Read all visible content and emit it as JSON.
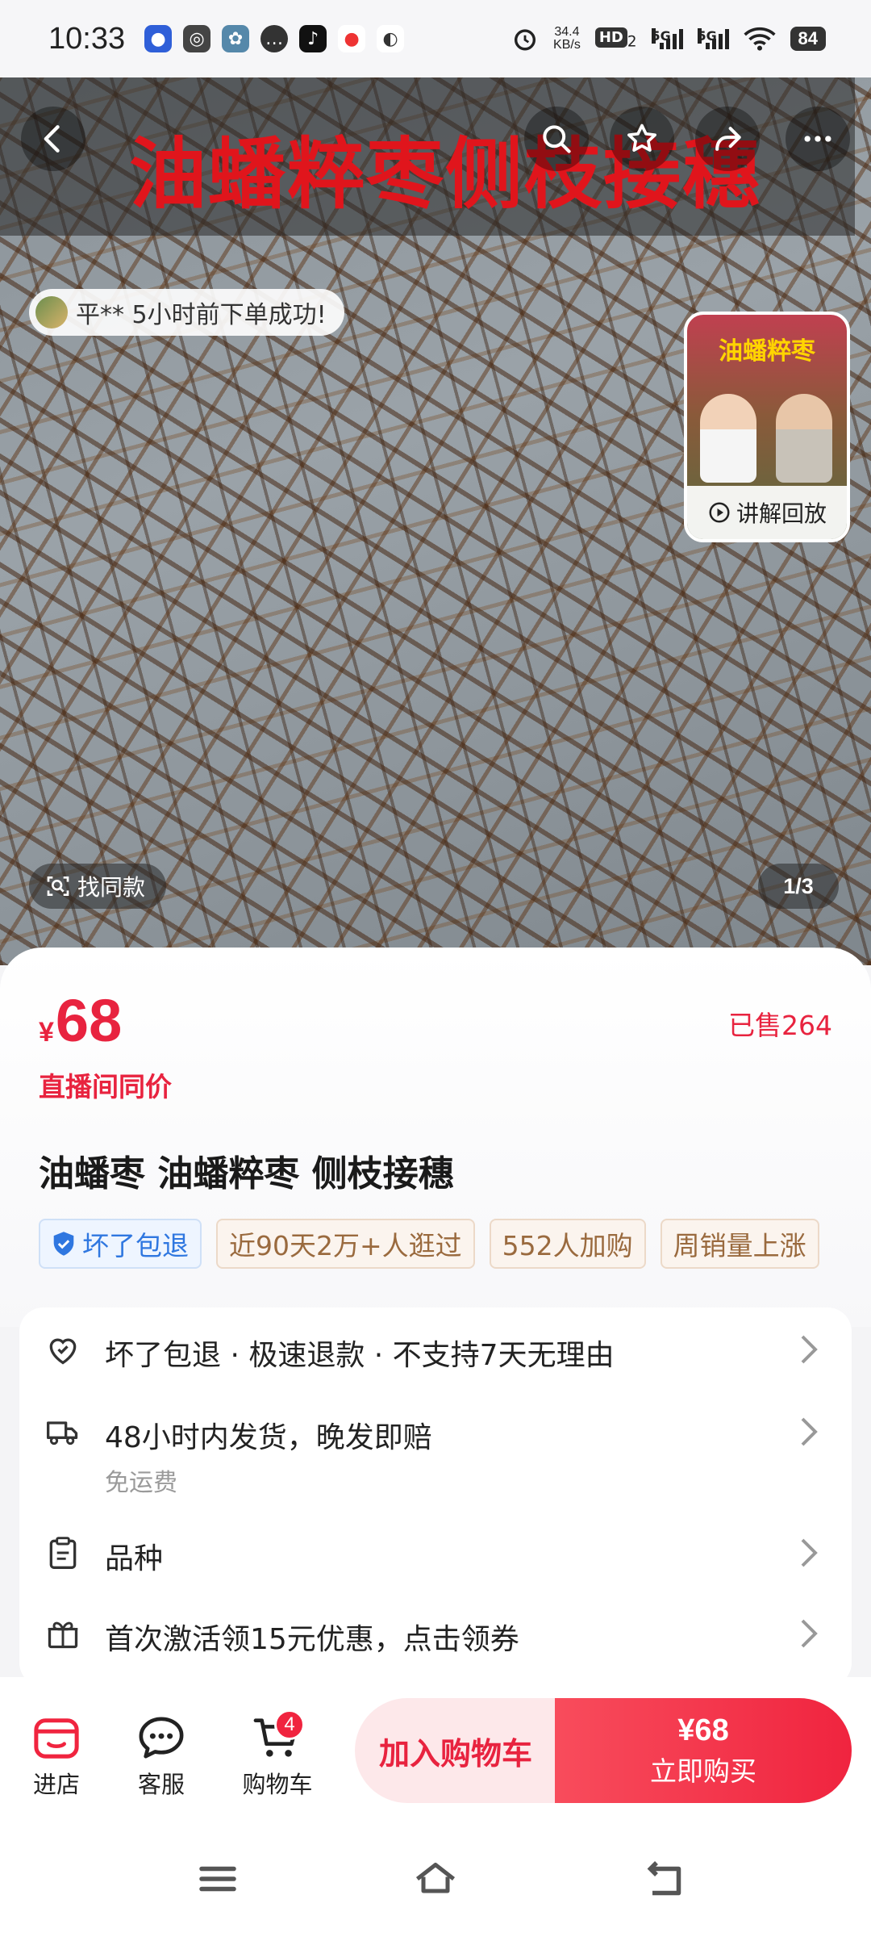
{
  "status_bar": {
    "time": "10:33",
    "net_speed_value": "34.4",
    "net_speed_unit": "KB/s",
    "hd_label": "HD",
    "hd_sub": "2",
    "signal1_label": "5G",
    "signal2_label": "5G",
    "battery": "84"
  },
  "hero": {
    "banner_text": "油蟠粹枣侧枝接穗",
    "order_toast": "平** 5小时前下单成功!",
    "replay_card_title": "油蟠粹枣",
    "replay_label": "讲解回放",
    "find_similar": "找同款",
    "pager": "1/3"
  },
  "product": {
    "currency": "¥",
    "price": "68",
    "sold": "已售264",
    "live_price_label": "直播间同价",
    "title": "油蟠枣 油蟠粹枣 侧枝接穗",
    "tags": [
      {
        "label": "坏了包退"
      },
      {
        "label": "近90天2万+人逛过"
      },
      {
        "label": "552人加购"
      },
      {
        "label": "周销量上涨"
      }
    ]
  },
  "services": {
    "guarantee": "坏了包退 · 极速退款 · 不支持7天无理由",
    "shipping": "48小时内发货，晚发即赔",
    "shipping_sub": "免运费",
    "variety": "品种",
    "coupon": "首次激活领15元优惠，点击领券"
  },
  "bottom_bar": {
    "shop": "进店",
    "service": "客服",
    "cart": "购物车",
    "cart_count": "4",
    "add_to_cart": "加入购物车",
    "buy_price": "¥68",
    "buy_now": "立即购买"
  },
  "colors": {
    "accent": "#e8233f",
    "banner_red": "#e0151c",
    "tag_blue": "#2f77e0",
    "tag_brown": "#9a6a3e"
  },
  "icons": {
    "hero": [
      "back-icon",
      "search-icon",
      "star-icon",
      "share-icon",
      "more-icon"
    ],
    "services": [
      "heart-shield-icon",
      "truck-icon",
      "clipboard-icon",
      "gift-icon"
    ],
    "bottom": [
      "shop-icon",
      "chat-icon",
      "cart-icon"
    ],
    "nav": [
      "menu-icon",
      "home-icon",
      "back-nav-icon"
    ]
  }
}
